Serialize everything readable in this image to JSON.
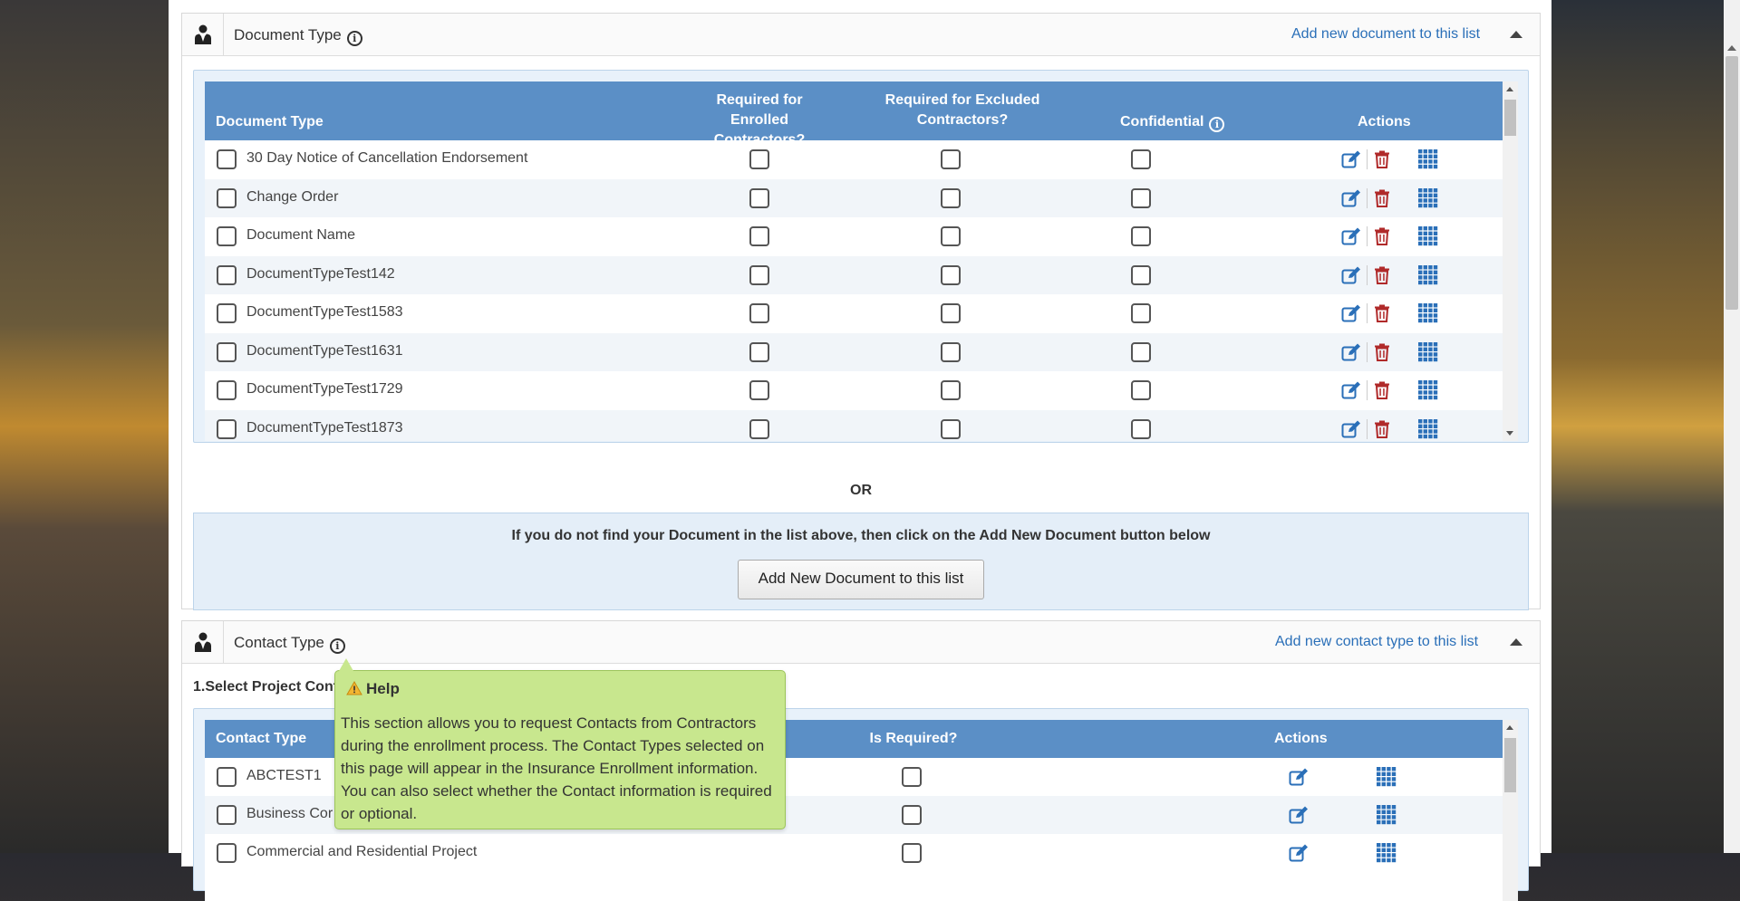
{
  "doc_panel": {
    "title": "Document Type",
    "add_link": "Add new document to this list",
    "columns": {
      "name": "Document Type",
      "enrolled": "Required for Enrolled Contractors?",
      "excluded": "Required for Excluded Contractors?",
      "confidential": "Confidential",
      "actions": "Actions"
    },
    "rows": [
      "30 Day Notice of Cancellation Endorsement",
      "Change Order",
      "Document Name",
      "DocumentTypeTest142",
      "DocumentTypeTest1583",
      "DocumentTypeTest1631",
      "DocumentTypeTest1729",
      "DocumentTypeTest1873"
    ],
    "or_text": "OR",
    "add_hint": "If you do not find your Document in the list above, then click on the Add New Document button below",
    "add_button": "Add New Document to this list"
  },
  "contact_panel": {
    "title": "Contact Type",
    "add_link": "Add new contact type to this list",
    "step_label": "1.Select Project Cont",
    "columns": {
      "name": "Contact Type",
      "required": "Is Required?",
      "actions": "Actions"
    },
    "rows": [
      "ABCTEST1",
      "Business Cor",
      "Commercial and Residential Project"
    ]
  },
  "tooltip": {
    "title": "Help",
    "body": "This section allows you to request Contacts from Contractors during the enrollment process. The Contact Types selected on this page will appear in the Insurance Enrollment information. You can also select whether the Contact information is required or optional."
  },
  "colors": {
    "header_blue": "#5b8fc6",
    "link_blue": "#2a6fb8",
    "delete_red": "#b02a2a",
    "tooltip_green": "#c8e78e"
  }
}
